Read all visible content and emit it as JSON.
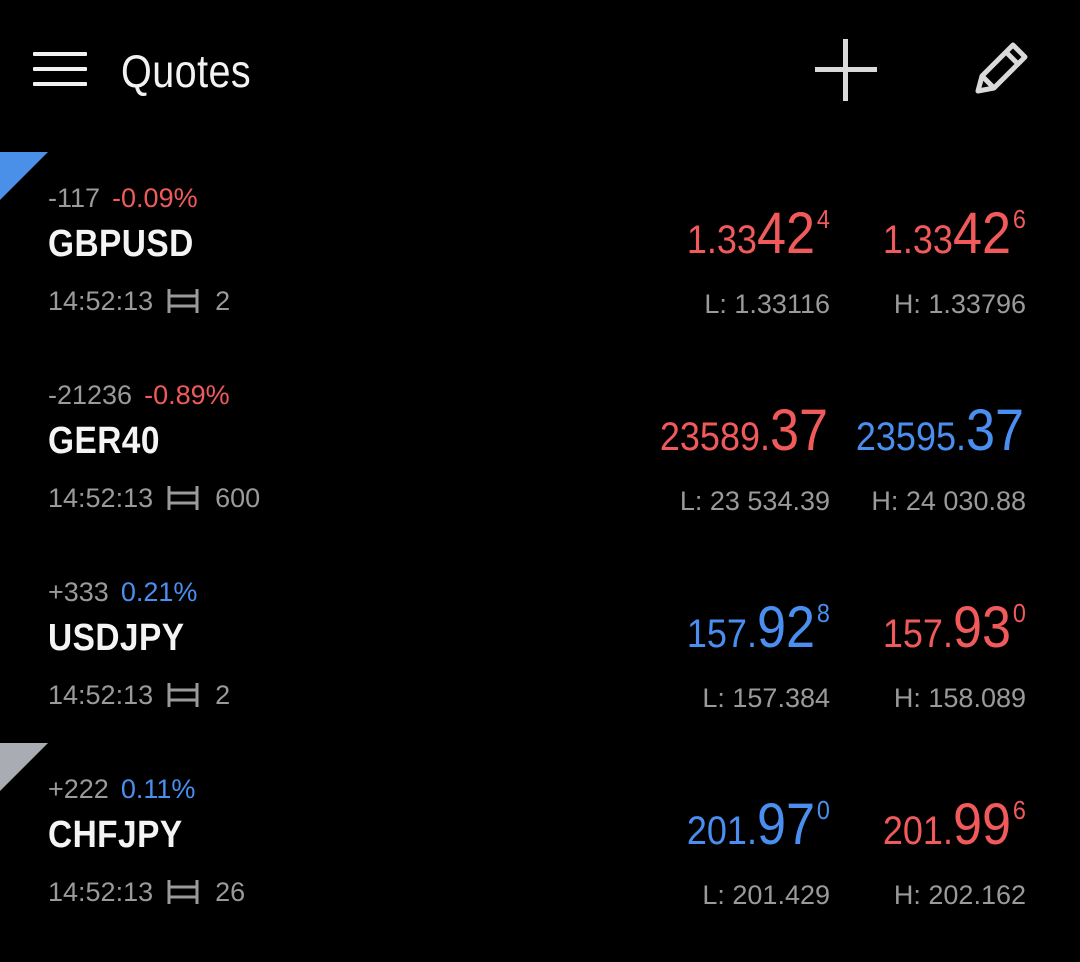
{
  "header": {
    "title": "Quotes"
  },
  "icons": {
    "menu": "hamburger-menu-icon",
    "add": "plus-icon",
    "edit": "pencil-icon",
    "spread": "spread-icon"
  },
  "colors": {
    "background": "#000000",
    "down": "#f05a5a",
    "up": "#4a8ff0",
    "secondary_text": "#9a9a9a",
    "marker_blue": "#4a90e8",
    "marker_gray": "#a9adb3"
  },
  "quotes": [
    {
      "symbol": "GBPUSD",
      "change_points": "-117",
      "change_percent": "-0.09%",
      "change_direction": "down",
      "time": "14:52:13",
      "spread": "2",
      "marker": "blue",
      "bid": {
        "small": "1.33",
        "big": "42",
        "sup": "4",
        "direction": "down"
      },
      "ask": {
        "small": "1.33",
        "big": "42",
        "sup": "6",
        "direction": "down"
      },
      "low": "L: 1.33116",
      "high": "H: 1.33796"
    },
    {
      "symbol": "GER40",
      "change_points": "-21236",
      "change_percent": "-0.89%",
      "change_direction": "down",
      "time": "14:52:13",
      "spread": "600",
      "marker": "none",
      "bid": {
        "small": "23589.",
        "big": "37",
        "sup": "",
        "direction": "down"
      },
      "ask": {
        "small": "23595.",
        "big": "37",
        "sup": "",
        "direction": "up"
      },
      "low": "L: 23 534.39",
      "high": "H: 24 030.88"
    },
    {
      "symbol": "USDJPY",
      "change_points": "+333",
      "change_percent": "0.21%",
      "change_direction": "up",
      "time": "14:52:13",
      "spread": "2",
      "marker": "none",
      "bid": {
        "small": "157.",
        "big": "92",
        "sup": "8",
        "direction": "up"
      },
      "ask": {
        "small": "157.",
        "big": "93",
        "sup": "0",
        "direction": "down"
      },
      "low": "L: 157.384",
      "high": "H: 158.089"
    },
    {
      "symbol": "CHFJPY",
      "change_points": "+222",
      "change_percent": "0.11%",
      "change_direction": "up",
      "time": "14:52:13",
      "spread": "26",
      "marker": "gray",
      "bid": {
        "small": "201.",
        "big": "97",
        "sup": "0",
        "direction": "up"
      },
      "ask": {
        "small": "201.",
        "big": "99",
        "sup": "6",
        "direction": "down"
      },
      "low": "L: 201.429",
      "high": "H: 202.162"
    }
  ]
}
